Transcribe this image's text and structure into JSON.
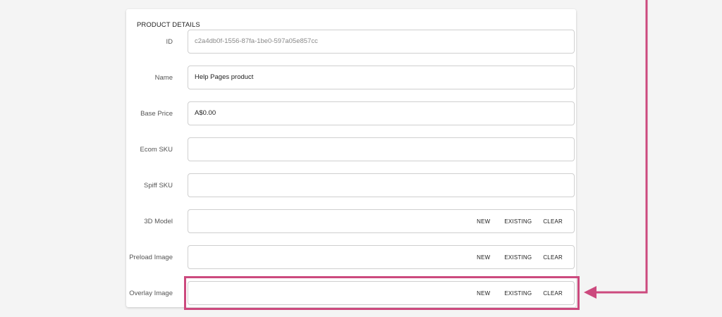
{
  "product_details": {
    "title": "PRODUCT DETAILS",
    "fields": {
      "id": {
        "label": "ID",
        "value": "c2a4db0f-1556-87fa-1be0-597a05e857cc"
      },
      "name": {
        "label": "Name",
        "value": "Help Pages product"
      },
      "base_price": {
        "label": "Base Price",
        "value": "A$0.00"
      },
      "ecom_sku": {
        "label": "Ecom SKU",
        "value": ""
      },
      "spiff_sku": {
        "label": "Spiff SKU",
        "value": ""
      },
      "model_3d": {
        "label": "3D Model"
      },
      "preload_image": {
        "label": "Preload Image"
      },
      "overlay_image": {
        "label": "Overlay Image"
      }
    },
    "actions": {
      "new": "NEW",
      "existing": "EXISTING",
      "clear": "CLEAR"
    }
  },
  "annotation": {
    "color": "#cc4a7e"
  }
}
